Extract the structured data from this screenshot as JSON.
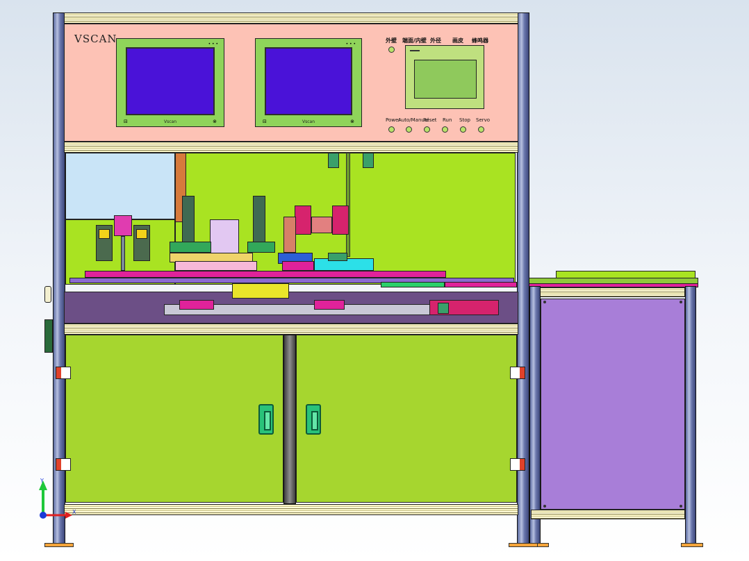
{
  "panel": {
    "brand": "VSCAN",
    "screen_brand_left": "Vscan",
    "screen_brand_right": "Vscan",
    "top_labels": [
      "外壁",
      "端面/内壁",
      "外径",
      "画皮",
      "蜂鸣器"
    ],
    "button_labels": [
      "Power",
      "Auto/Manual",
      "Reset",
      "Run",
      "Stop",
      "Servo"
    ]
  },
  "axes": {
    "y_label": "Y",
    "x_label": "X"
  },
  "colors": {
    "panel_bg": "#fdc2b5",
    "machine_bg": "#a9e322",
    "cabinet_door": "#a6d62f",
    "side_cabinet": "#a87ed8",
    "screen": "#4a12d8",
    "hmi": "#8fc95c",
    "frame": "#6b78ad",
    "magenta": "#e0229a",
    "cyan": "#2ce0e8"
  }
}
